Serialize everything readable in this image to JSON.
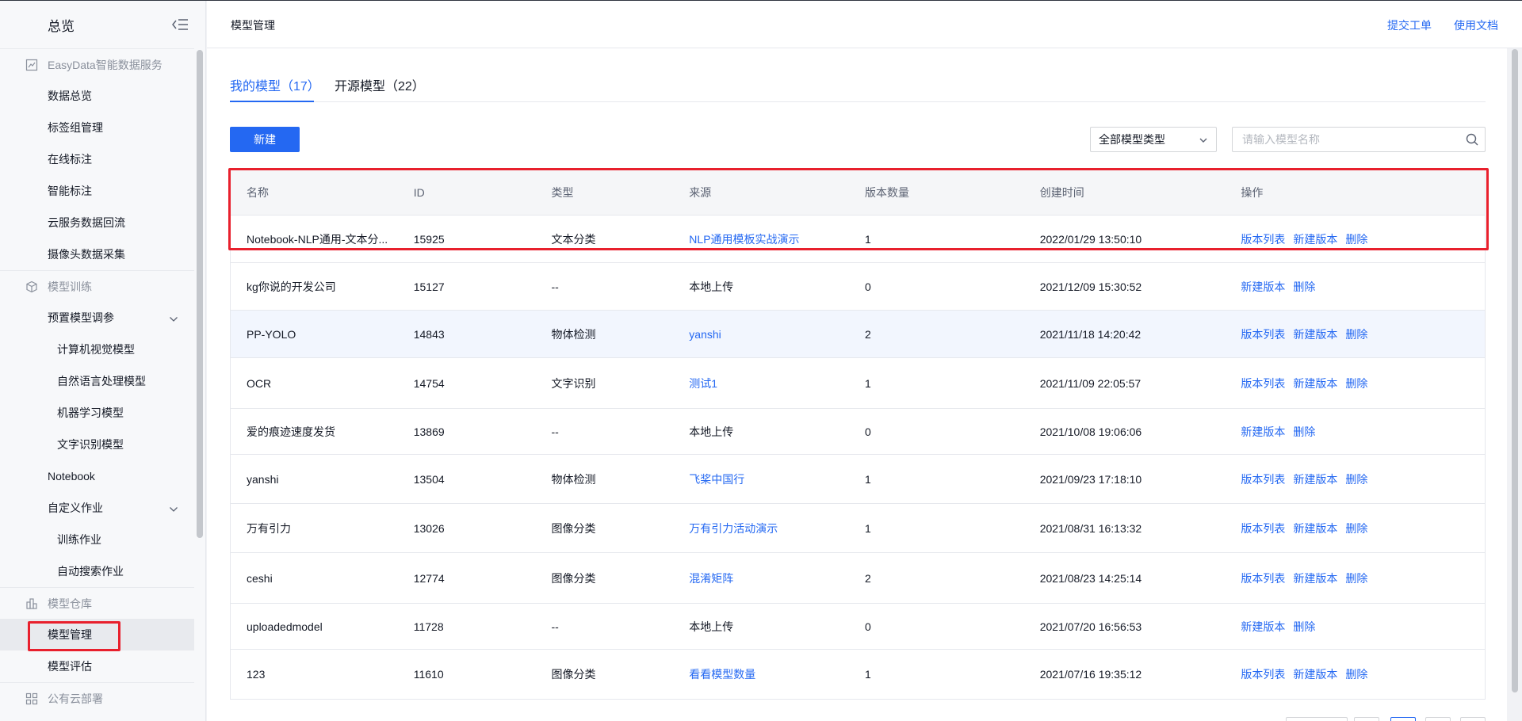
{
  "sidebar": {
    "title": "总览",
    "groups": [
      {
        "label": "EasyData智能数据服务",
        "icon": "chart-line-icon",
        "items": [
          {
            "label": "数据总览"
          },
          {
            "label": "标签组管理"
          },
          {
            "label": "在线标注"
          },
          {
            "label": "智能标注"
          },
          {
            "label": "云服务数据回流"
          },
          {
            "label": "摄像头数据采集"
          }
        ]
      },
      {
        "label": "模型训练",
        "icon": "cube-icon",
        "items": [
          {
            "label": "预置模型调参",
            "expandable": true
          },
          {
            "label": "计算机视觉模型",
            "sub": true
          },
          {
            "label": "自然语言处理模型",
            "sub": true
          },
          {
            "label": "机器学习模型",
            "sub": true
          },
          {
            "label": "文字识别模型",
            "sub": true
          },
          {
            "label": "Notebook"
          },
          {
            "label": "自定义作业",
            "expandable": true
          },
          {
            "label": "训练作业",
            "sub": true
          },
          {
            "label": "自动搜索作业",
            "sub": true
          }
        ]
      },
      {
        "label": "模型仓库",
        "icon": "warehouse-icon",
        "items": [
          {
            "label": "模型管理",
            "active": true
          },
          {
            "label": "模型评估"
          }
        ]
      },
      {
        "label": "公有云部署",
        "icon": "deploy-icon",
        "items": []
      }
    ]
  },
  "header": {
    "title": "模型管理",
    "links": [
      "提交工单",
      "使用文档"
    ]
  },
  "tabs": [
    {
      "label": "我的模型（17）",
      "active": true
    },
    {
      "label": "开源模型（22）",
      "active": false
    }
  ],
  "toolbar": {
    "new_label": "新建",
    "type_select": "全部模型类型",
    "search_placeholder": "请输入模型名称"
  },
  "table": {
    "columns": [
      "名称",
      "ID",
      "类型",
      "来源",
      "版本数量",
      "创建时间",
      "操作"
    ],
    "rows": [
      {
        "name": "Notebook-NLP通用-文本分...",
        "id": "15925",
        "type": "文本分类",
        "source": "NLP通用模板实战演示",
        "source_link": true,
        "versions": "1",
        "time": "2022/01/29 13:50:10",
        "ops": [
          "版本列表",
          "新建版本",
          "删除"
        ]
      },
      {
        "name": "kg你说的开发公司",
        "id": "15127",
        "type": "--",
        "source": "本地上传",
        "source_link": false,
        "versions": "0",
        "time": "2021/12/09 15:30:52",
        "ops": [
          "新建版本",
          "删除"
        ]
      },
      {
        "name": "PP-YOLO",
        "id": "14843",
        "type": "物体检测",
        "source": "yanshi",
        "source_link": true,
        "versions": "2",
        "time": "2021/11/18 14:20:42",
        "ops": [
          "版本列表",
          "新建版本",
          "删除"
        ]
      },
      {
        "name": "OCR",
        "id": "14754",
        "type": "文字识别",
        "source": "测试1",
        "source_link": true,
        "versions": "1",
        "time": "2021/11/09 22:05:57",
        "ops": [
          "版本列表",
          "新建版本",
          "删除"
        ]
      },
      {
        "name": "爱的痕迹速度发货",
        "id": "13869",
        "type": "--",
        "source": "本地上传",
        "source_link": false,
        "versions": "0",
        "time": "2021/10/08 19:06:06",
        "ops": [
          "新建版本",
          "删除"
        ]
      },
      {
        "name": "yanshi",
        "id": "13504",
        "type": "物体检测",
        "source": "飞桨中国行",
        "source_link": true,
        "versions": "1",
        "time": "2021/09/23 17:18:10",
        "ops": [
          "版本列表",
          "新建版本",
          "删除"
        ]
      },
      {
        "name": "万有引力",
        "id": "13026",
        "type": "图像分类",
        "source": "万有引力活动演示",
        "source_link": true,
        "versions": "1",
        "time": "2021/08/31 16:13:32",
        "ops": [
          "版本列表",
          "新建版本",
          "删除"
        ]
      },
      {
        "name": "ceshi",
        "id": "12774",
        "type": "图像分类",
        "source": "混淆矩阵",
        "source_link": true,
        "versions": "2",
        "time": "2021/08/23 14:25:14",
        "ops": [
          "版本列表",
          "新建版本",
          "删除"
        ]
      },
      {
        "name": "uploadedmodel",
        "id": "11728",
        "type": "--",
        "source": "本地上传",
        "source_link": false,
        "versions": "0",
        "time": "2021/07/20 16:56:53",
        "ops": [
          "新建版本",
          "删除"
        ]
      },
      {
        "name": "123",
        "id": "11610",
        "type": "图像分类",
        "source": "看看模型数量",
        "source_link": true,
        "versions": "1",
        "time": "2021/07/16 19:35:12",
        "ops": [
          "版本列表",
          "新建版本",
          "删除"
        ]
      }
    ]
  },
  "colors": {
    "accent": "#2468f2",
    "highlight": "#e8202d"
  }
}
